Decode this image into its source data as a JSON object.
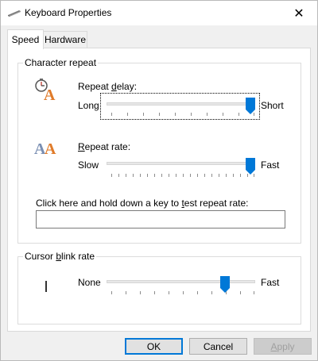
{
  "window": {
    "title": "Keyboard Properties",
    "close_symbol": "✕"
  },
  "tabs": [
    {
      "label": "Speed",
      "selected": true
    },
    {
      "label": "Hardware",
      "selected": false
    }
  ],
  "character_repeat": {
    "group_label": "Character repeat",
    "repeat_delay": {
      "label_prefix": "Repeat ",
      "label_underlined": "d",
      "label_suffix": "elay:",
      "min_label": "Long",
      "max_label": "Short",
      "value_fraction": 1.0,
      "icon": "keyboard-delay-icon"
    },
    "repeat_rate": {
      "label_underlined": "R",
      "label_suffix": "epeat rate:",
      "min_label": "Slow",
      "max_label": "Fast",
      "value_fraction": 1.0,
      "icon": "keyboard-rate-icon"
    },
    "test_label_prefix": "Click here and hold down a key to ",
    "test_label_underlined": "t",
    "test_label_suffix": "est repeat rate:",
    "test_value": ""
  },
  "cursor_blink": {
    "group_label_prefix": "Cursor ",
    "group_label_underlined": "b",
    "group_label_suffix": "link rate",
    "min_label": "None",
    "max_label": "Fast",
    "value_fraction": 0.8,
    "icon": "cursor-icon"
  },
  "buttons": {
    "ok": "OK",
    "cancel": "Cancel",
    "apply_underlined": "A",
    "apply_suffix": "pply"
  },
  "colors": {
    "accent": "#0078d7",
    "thumb": "#0078d7"
  }
}
